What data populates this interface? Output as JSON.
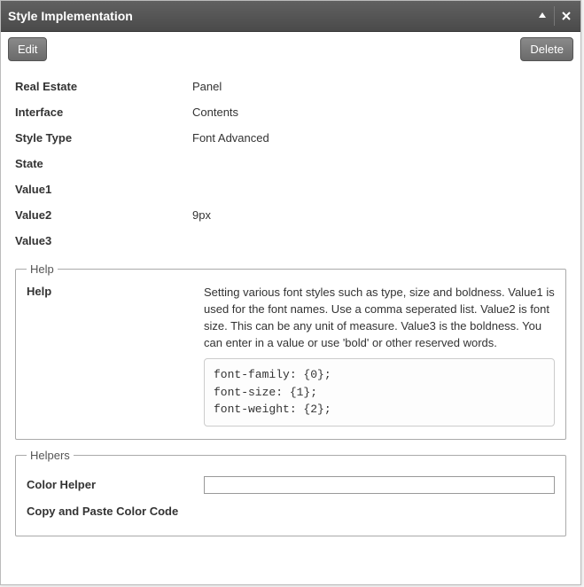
{
  "window": {
    "title": "Style Implementation"
  },
  "toolbar": {
    "edit_label": "Edit",
    "delete_label": "Delete"
  },
  "fields": {
    "real_estate": {
      "label": "Real Estate",
      "value": "Panel"
    },
    "interface": {
      "label": "Interface",
      "value": "Contents"
    },
    "style_type": {
      "label": "Style Type",
      "value": "Font Advanced"
    },
    "state": {
      "label": "State",
      "value": ""
    },
    "value1": {
      "label": "Value1",
      "value": ""
    },
    "value2": {
      "label": "Value2",
      "value": "9px"
    },
    "value3": {
      "label": "Value3",
      "value": ""
    }
  },
  "help": {
    "legend": "Help",
    "label": "Help",
    "text": "Setting various font styles such as type, size and boldness. Value1 is used for the font names. Use a comma seperated list. Value2 is font size. This can be any unit of measure. Value3 is the boldness. You can enter in a value or use 'bold' or other reserved words.",
    "code": "font-family: {0};\nfont-size: {1};\nfont-weight: {2};"
  },
  "helpers": {
    "legend": "Helpers",
    "color_helper_label": "Color Helper",
    "color_helper_value": "",
    "copy_paste_label": "Copy and Paste Color Code"
  }
}
